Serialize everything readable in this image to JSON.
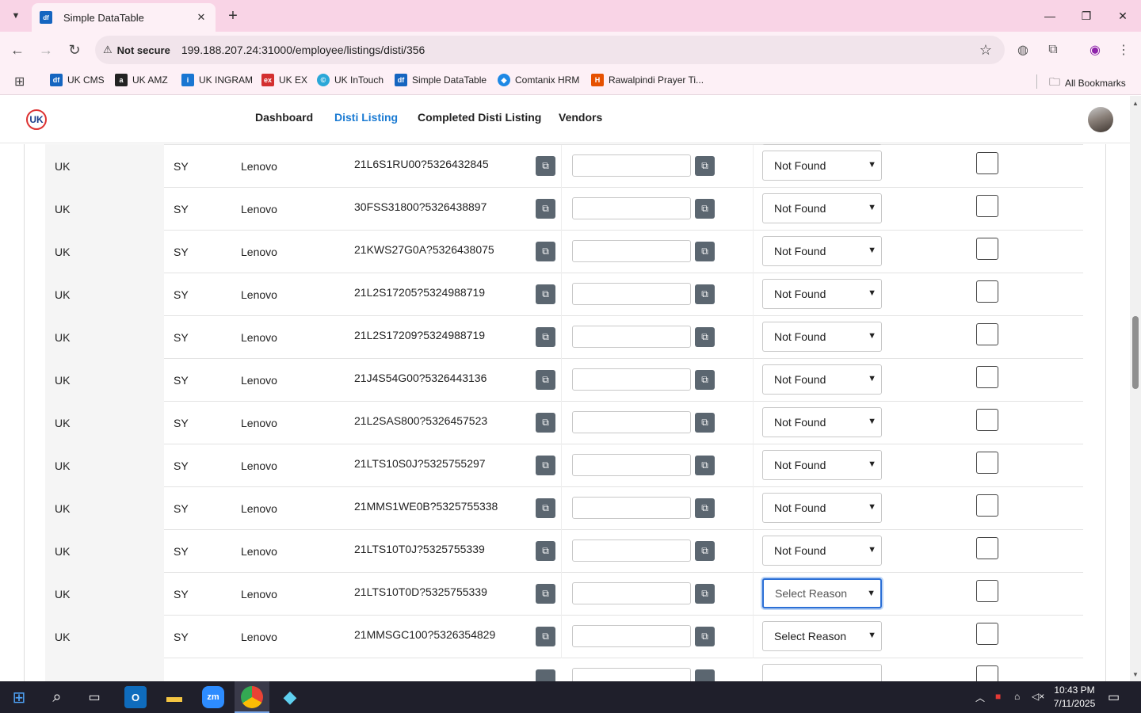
{
  "browser": {
    "tab_title": "Simple DataTable",
    "tab_favicon": "df",
    "not_secure": "Not secure",
    "url": "199.188.207.24:31000/employee/listings/disti/356",
    "bookmarks": [
      {
        "label": "UK CMS",
        "icon": "df",
        "color": "#1565c0"
      },
      {
        "label": "UK AMZ",
        "icon": "a",
        "color": "#222222"
      },
      {
        "label": "UK INGRAM",
        "icon": "i",
        "color": "#1976d2"
      },
      {
        "label": "UK EX",
        "icon": "ex",
        "color": "#d32f2f"
      },
      {
        "label": "UK InTouch",
        "icon": "©",
        "color": "#2aa7d8"
      },
      {
        "label": "Simple DataTable",
        "icon": "df",
        "color": "#1565c0"
      },
      {
        "label": "Comtanix HRM",
        "icon": "◆",
        "color": "#1e88e5"
      },
      {
        "label": "Rawalpindi Prayer Ti...",
        "icon": "H",
        "color": "#e65100"
      }
    ],
    "all_bookmarks": "All Bookmarks"
  },
  "app": {
    "logo": "UK",
    "nav": [
      "Dashboard",
      "Disti Listing",
      "Completed Disti Listing",
      "Vendors"
    ],
    "active_nav": "Disti Listing"
  },
  "table": {
    "rows": [
      {
        "region": "UK",
        "code": "SY",
        "brand": "Lenovo",
        "sku": "21L6S1RU00?5326432845",
        "reason": "Not Found"
      },
      {
        "region": "UK",
        "code": "SY",
        "brand": "Lenovo",
        "sku": "30FSS31800?5326438897",
        "reason": "Not Found"
      },
      {
        "region": "UK",
        "code": "SY",
        "brand": "Lenovo",
        "sku": "21KWS27G0A?5326438075",
        "reason": "Not Found"
      },
      {
        "region": "UK",
        "code": "SY",
        "brand": "Lenovo",
        "sku": "21L2S17205?5324988719",
        "reason": "Not Found"
      },
      {
        "region": "UK",
        "code": "SY",
        "brand": "Lenovo",
        "sku": "21L2S17209?5324988719",
        "reason": "Not Found"
      },
      {
        "region": "UK",
        "code": "SY",
        "brand": "Lenovo",
        "sku": "21J4S54G00?5326443136",
        "reason": "Not Found"
      },
      {
        "region": "UK",
        "code": "SY",
        "brand": "Lenovo",
        "sku": "21L2SAS800?5326457523",
        "reason": "Not Found"
      },
      {
        "region": "UK",
        "code": "SY",
        "brand": "Lenovo",
        "sku": "21LTS10S0J?5325755297",
        "reason": "Not Found"
      },
      {
        "region": "UK",
        "code": "SY",
        "brand": "Lenovo",
        "sku": "21MMS1WE0B?5325755338",
        "reason": "Not Found"
      },
      {
        "region": "UK",
        "code": "SY",
        "brand": "Lenovo",
        "sku": "21LTS10T0J?5325755339",
        "reason": "Not Found"
      },
      {
        "region": "UK",
        "code": "SY",
        "brand": "Lenovo",
        "sku": "21LTS10T0D?5325755339",
        "reason": "Select Reason",
        "focused": true
      },
      {
        "region": "UK",
        "code": "SY",
        "brand": "Lenovo",
        "sku": "21MMSGC100?5326354829",
        "reason": "Select Reason"
      }
    ]
  },
  "taskbar": {
    "time": "10:43 PM",
    "date": "7/11/2025"
  }
}
